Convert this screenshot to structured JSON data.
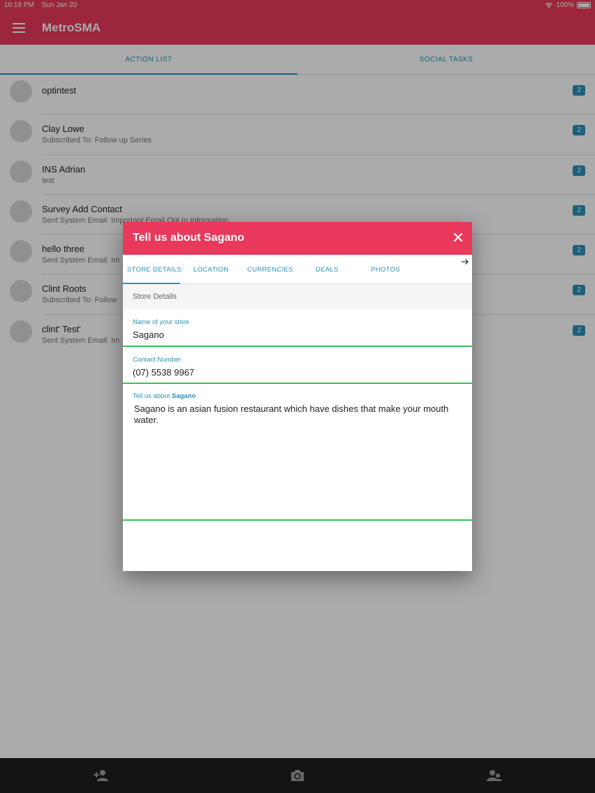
{
  "status_bar": {
    "time": "10:19 PM",
    "date": "Sun Jan 20",
    "battery": "100%"
  },
  "app": {
    "title": "MetroSMA",
    "menu_icon": "hamburger-menu-icon"
  },
  "tabs": [
    {
      "label": "ACTION LIST",
      "active": true
    },
    {
      "label": "SOCIAL TASKS",
      "active": false
    }
  ],
  "action_list": [
    {
      "name": "optintest",
      "sub": "",
      "badge": "2"
    },
    {
      "name": "Clay Lowe",
      "sub": "Subscribed To: Follow up Series",
      "badge": "2"
    },
    {
      "name": "INS Adrian",
      "sub": "test",
      "badge": "2"
    },
    {
      "name": "Survey Add Contact",
      "sub": "Sent System Email: Important Email Opt In Information",
      "badge": "2"
    },
    {
      "name": "hello three",
      "sub": "Sent System Email: Im",
      "badge": "2"
    },
    {
      "name": "Clint Roots",
      "sub": "Subscribed To: Follow",
      "badge": "2"
    },
    {
      "name": "clint' Test'",
      "sub": "Sent System Email: Im",
      "badge": "2"
    }
  ],
  "dialog": {
    "title": "Tell us about Sagano",
    "tabs": [
      "STORE DETAILS",
      "LOCATION",
      "CURRENCIES",
      "DEALS",
      "PHOTOS"
    ],
    "active_tab": "STORE DETAILS",
    "section_title": "Store Details",
    "store_name": {
      "label": "Name of your store",
      "value": "Sagano"
    },
    "contact_number": {
      "label": "Contact Number",
      "value": "(07) 5538 9967"
    },
    "about": {
      "label_prefix": "Tell us about",
      "label_name": "Sagano",
      "value": "Sagano is an asian fusion restaurant which have dishes that make your mouth water."
    }
  },
  "bottom_bar": {
    "icons": [
      "add-contact-icon",
      "camera-icon",
      "group-contacts-icon"
    ]
  },
  "colors": {
    "brand": "#e8395c",
    "accent": "#2a8fb7",
    "field_line": "#36c25a",
    "bottom_bar": "#1f1f1f"
  }
}
